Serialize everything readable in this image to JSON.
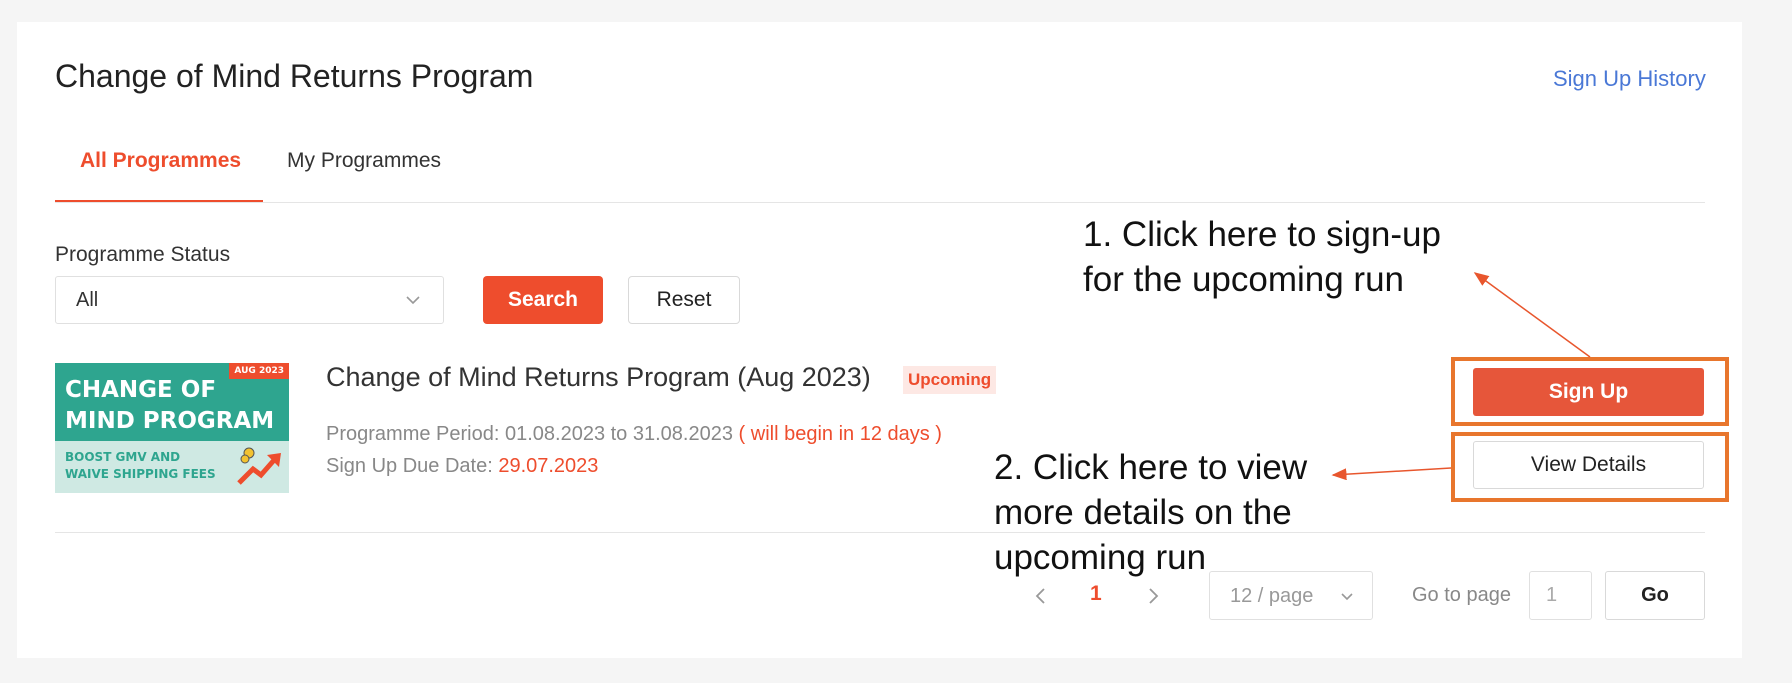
{
  "header": {
    "title": "Change of Mind Returns Program",
    "history_link": "Sign Up History"
  },
  "tabs": [
    {
      "label": "All Programmes",
      "active": true
    },
    {
      "label": "My Programmes",
      "active": false
    }
  ],
  "filter": {
    "status_label": "Programme Status",
    "status_value": "All",
    "search_label": "Search",
    "reset_label": "Reset"
  },
  "program": {
    "banner": {
      "badge": "AUG 2023",
      "title": "CHANGE OF\nMIND PROGRAM",
      "subtitle": "BOOST GMV AND\nWAIVE SHIPPING FEES"
    },
    "title": "Change of Mind Returns Program (Aug 2023)",
    "status": "Upcoming",
    "period_label": "Programme Period: ",
    "period_value": "01.08.2023 to 31.08.2023",
    "period_note": "( will begin in 12 days )",
    "due_label": "Sign Up Due Date: ",
    "due_value": "29.07.2023",
    "signup_label": "Sign Up",
    "details_label": "View Details"
  },
  "annotations": {
    "signup_hint": "1. Click here to sign-up\nfor the upcoming run",
    "details_hint": "2. Click here to view\nmore details on the\nupcoming run"
  },
  "pagination": {
    "current_page": "1",
    "page_size": "12 / page",
    "goto_label": "Go to page",
    "goto_value": "1",
    "go_label": "Go"
  },
  "colors": {
    "accent": "#ee4d2d",
    "annotation": "#e8762d",
    "link": "#4a78d6",
    "banner_green": "#2ea58f"
  }
}
